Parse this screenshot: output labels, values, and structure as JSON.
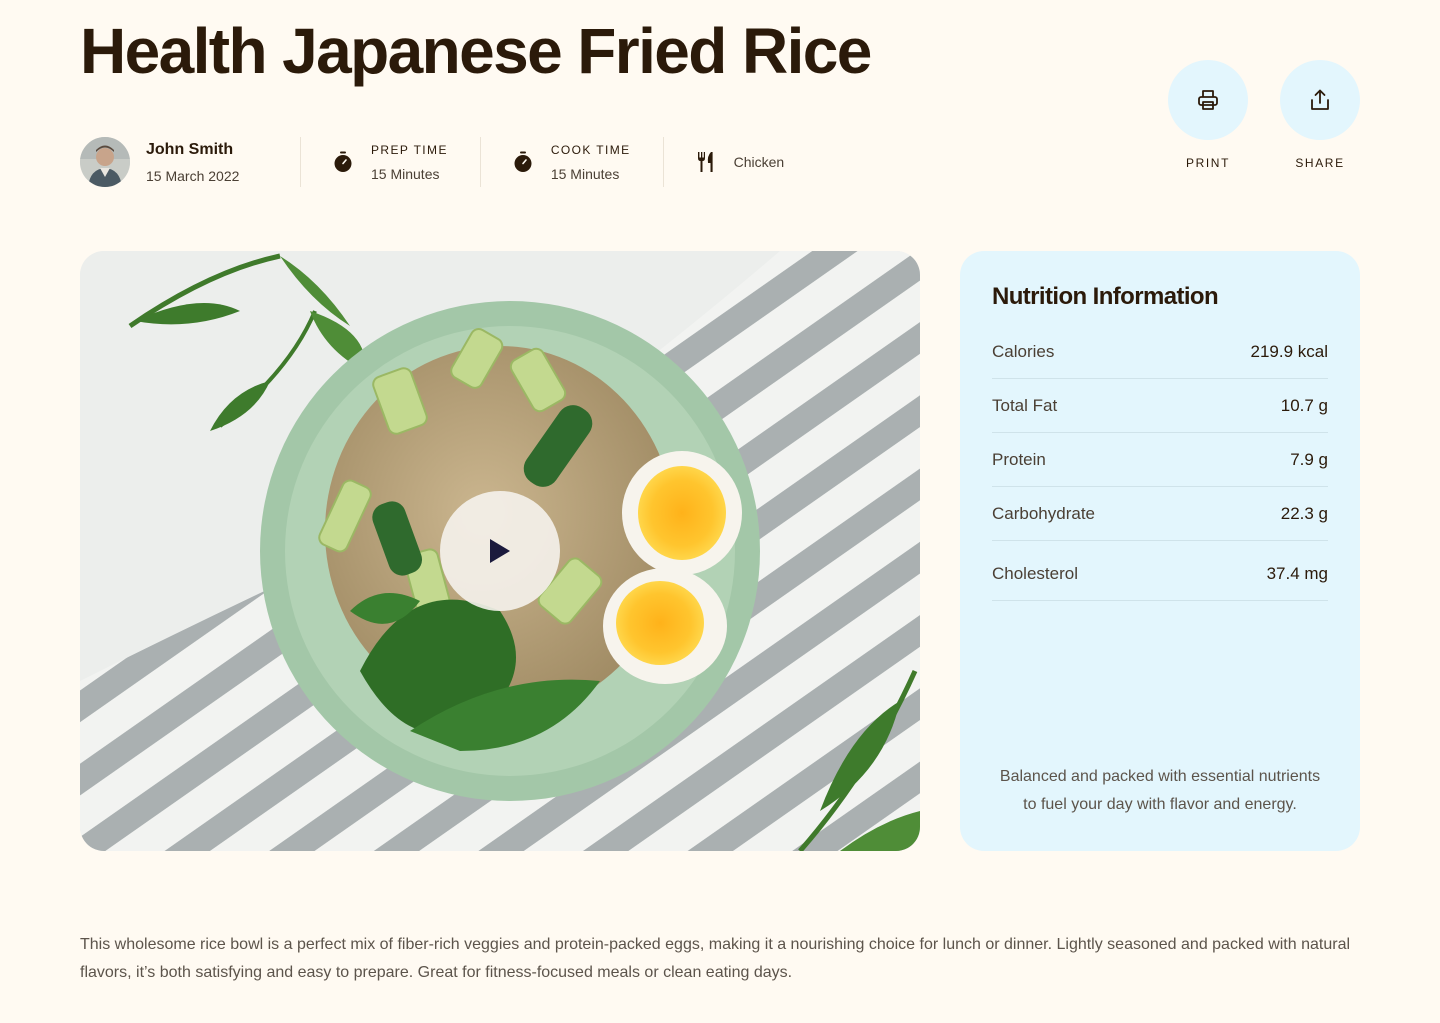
{
  "recipe": {
    "title": "Health Japanese Fried Rice",
    "description": "This wholesome rice bowl is a perfect mix of fiber-rich veggies and protein-packed eggs, making it a nourishing choice for lunch or dinner. Lightly seasoned and packed with natural flavors, it’s both satisfying and easy to prepare. Great for fitness-focused meals or clean eating days."
  },
  "author": {
    "name": "John Smith",
    "date": "15 March 2022"
  },
  "meta": {
    "prep": {
      "label": "PREP TIME",
      "value": "15 Minutes",
      "icon": "timer-icon"
    },
    "cook": {
      "label": "COOK TIME",
      "value": "15 Minutes",
      "icon": "timer-icon"
    },
    "category": {
      "value": "Chicken",
      "icon": "fork-knife-icon"
    }
  },
  "actions": {
    "print": {
      "label": "PRINT",
      "icon": "printer-icon"
    },
    "share": {
      "label": "SHARE",
      "icon": "share-icon"
    }
  },
  "nutrition": {
    "title": "Nutrition Information",
    "rows": [
      {
        "label": "Calories",
        "value": "219.9 kcal"
      },
      {
        "label": "Total Fat",
        "value": "10.7 g"
      },
      {
        "label": "Protein",
        "value": "7.9 g"
      },
      {
        "label": "Carbohydrate",
        "value": "22.3 g"
      },
      {
        "label": "Cholesterol",
        "value": "37.4 mg"
      }
    ],
    "note_line1": "Balanced and packed with essential nutrients",
    "note_line2": "to fuel your day with flavor and energy."
  },
  "colors": {
    "background": "#fffaf2",
    "accent_light_blue": "#e3f6fd",
    "heading": "#2b1a0a",
    "play_icon": "#1b1a3d"
  }
}
